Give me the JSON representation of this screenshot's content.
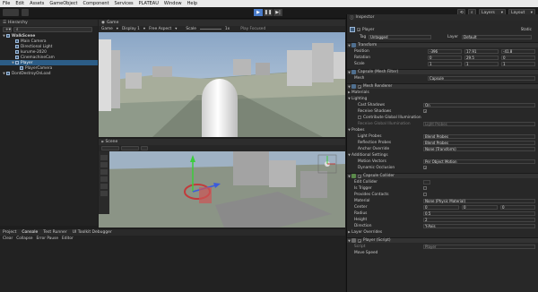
{
  "menu": [
    "File",
    "Edit",
    "Assets",
    "GameObject",
    "Component",
    "Services",
    "PLATEAU",
    "Window",
    "Help"
  ],
  "toolbar": {
    "layers": "Layers",
    "layout": "Layout"
  },
  "hierarchy": {
    "tab": "Hierarchy",
    "items": [
      {
        "label": "WalkScene",
        "indent": 0,
        "bold": true,
        "sel": false
      },
      {
        "label": "Main Camera",
        "indent": 2,
        "sel": false
      },
      {
        "label": "Directional Light",
        "indent": 2,
        "sel": false
      },
      {
        "label": "kurume-2020",
        "indent": 2,
        "sel": false
      },
      {
        "label": "CinemachineCam",
        "indent": 2,
        "sel": false
      },
      {
        "label": "Player",
        "indent": 2,
        "sel": true
      },
      {
        "label": "PlayerCamera",
        "indent": 3,
        "sel": false
      },
      {
        "label": "DontDestroyOnLoad",
        "indent": 0,
        "bold": false,
        "sel": false
      }
    ]
  },
  "game": {
    "tab": "Game",
    "display": "Display 1",
    "aspect": "Free Aspect",
    "scale_label": "Scale",
    "scale_value": "1x",
    "play_focused": "Play Focused"
  },
  "scene": {
    "tab": "Scene"
  },
  "bottom": {
    "tabs": [
      "Project",
      "Console",
      "Test Runner",
      "UI Toolkit Debugger"
    ],
    "clear": "Clear",
    "collapse": "Collapse",
    "error_pause": "Error Pause",
    "editor": "Editor"
  },
  "inspector": {
    "tab": "Inspector",
    "name": "Player",
    "static": "Static",
    "tag_label": "Tag",
    "tag": "Untagged",
    "layer_label": "Layer",
    "layer": "Default",
    "transform": "Transform",
    "position": "Position",
    "rotation": "Rotation",
    "scale": "Scale",
    "pos": [
      "-396",
      "17.91",
      "-41.8"
    ],
    "rot": [
      "0",
      "29.5",
      "0"
    ],
    "scl": [
      "1",
      "1",
      "1"
    ],
    "mesh_filter": "Capsule (Mesh Filter)",
    "mesh_label": "Mesh",
    "mesh_value": "Capsule",
    "mesh_renderer": "Mesh Renderer",
    "materials": "Materials",
    "lighting": "Lighting",
    "cast_shadows": "Cast Shadows",
    "cast_shadows_val": "On",
    "receive_shadows": "Receive Shadows",
    "contribute_gi": "Contribute Global Illumination",
    "receive_gi": "Receive Global Illumination",
    "receive_gi_val": "Light Probes",
    "probes": "Probes",
    "light_probes": "Light Probes",
    "light_probes_val": "Blend Probes",
    "reflection_probes": "Reflection Probes",
    "reflection_probes_val": "Blend Probes",
    "anchor_override": "Anchor Override",
    "anchor_override_val": "None (Transform)",
    "additional": "Additional Settings",
    "motion_vectors": "Motion Vectors",
    "motion_vectors_val": "Per Object Motion",
    "dynamic_occlusion": "Dynamic Occlusion",
    "capsule_collider": "Capsule Collider",
    "edit_collider": "Edit Collider",
    "is_trigger": "Is Trigger",
    "provides_contacts": "Provides Contacts",
    "material": "Material",
    "material_val": "None (Physic Material)",
    "center": "Center",
    "center_v": [
      "0",
      "0",
      "0"
    ],
    "radius": "Radius",
    "radius_v": "0.5",
    "height": "Height",
    "height_v": "2",
    "direction": "Direction",
    "direction_v": "Y-Axis",
    "layer_overrides": "Layer Overrides",
    "player_script": "Player (Script)",
    "script_label": "Script",
    "script_val": "Player",
    "move_speed": "Move Speed"
  }
}
